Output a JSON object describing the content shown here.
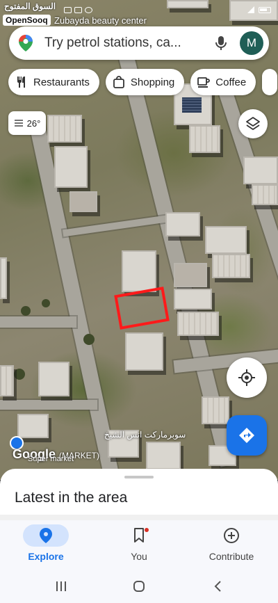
{
  "watermark": {
    "arabic": "السوق المفتوح",
    "brand": "OpenSooq"
  },
  "status_bar": {
    "place_label": "Zubayda beauty center"
  },
  "search": {
    "placeholder": "Try petrol stations, ca...",
    "avatar_initial": "M"
  },
  "chips": [
    {
      "label": "Restaurants",
      "icon": "fork-knife-icon"
    },
    {
      "label": "Shopping",
      "icon": "shopping-bag-icon"
    },
    {
      "label": "Coffee",
      "icon": "coffee-cup-icon"
    }
  ],
  "weather": {
    "temp": "26°",
    "icon": "haze-icon"
  },
  "map": {
    "poi_arabic": "سوبرماركت انس\nالشيخ",
    "poi_english": "(MARKET)",
    "google_logo": "Google",
    "poi_sub": "Super market",
    "parcel_color": "#ff1a1a"
  },
  "sheet": {
    "title": "Latest in the area"
  },
  "nav": {
    "items": [
      {
        "label": "Explore",
        "icon": "location-pin-icon",
        "active": true
      },
      {
        "label": "You",
        "icon": "bookmark-icon",
        "active": false
      },
      {
        "label": "Contribute",
        "icon": "add-circle-icon",
        "active": false
      }
    ]
  },
  "colors": {
    "accent": "#1a73e8",
    "active_pill": "#d3e3fd"
  }
}
